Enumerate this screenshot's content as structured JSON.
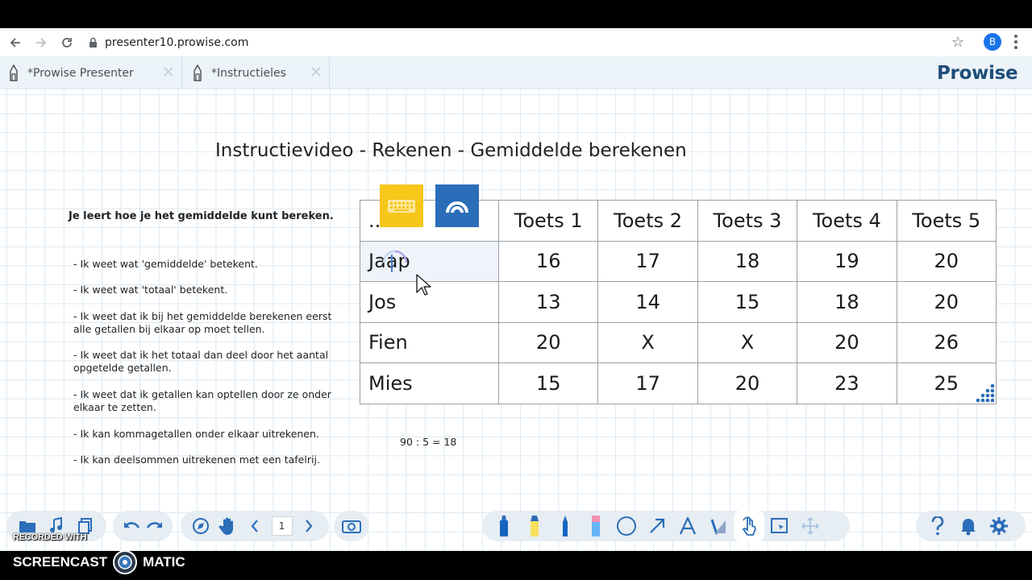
{
  "browser": {
    "url": "presenter10.prowise.com",
    "profile_initial": "B"
  },
  "tabs": [
    {
      "label": "*Prowise Presenter",
      "active": false
    },
    {
      "label": "*Instructieles",
      "active": true
    }
  ],
  "logo": "Prowise",
  "lesson": {
    "title": "Instructievideo - Rekenen - Gemiddelde berekenen",
    "intro": "Je leert hoe je het gemiddelde kunt bereken.",
    "goals": [
      "- Ik weet wat 'gemiddelde' betekent.",
      "- Ik weet wat 'totaal' betekent.",
      "- Ik weet dat ik bij het gemiddelde berekenen eerst alle getallen bij elkaar op moet tellen.",
      "- Ik weet dat ik het totaal dan deel door het aantal opgetelde getallen.",
      "- Ik weet dat ik getallen kan optellen door ze onder elkaar te zetten.",
      "- Ik kan kommagetallen onder elkaar uitrekenen.",
      "- Ik kan deelsommen uitrekenen met een tafelrij."
    ],
    "calculation": "90 : 5 = 18"
  },
  "table": {
    "headers": [
      "...",
      "Toets 1",
      "Toets 2",
      "Toets 3",
      "Toets 4",
      "Toets 5"
    ],
    "rows": [
      [
        "Jaap",
        "16",
        "17",
        "18",
        "19",
        "20"
      ],
      [
        "Jos",
        "13",
        "14",
        "15",
        "18",
        "20"
      ],
      [
        "Fien",
        "20",
        "X",
        "X",
        "20",
        "26"
      ],
      [
        "Mies",
        "15",
        "17",
        "20",
        "23",
        "25"
      ]
    ]
  },
  "toolbar": {
    "page_number": "1"
  },
  "watermark": {
    "top": "RECORDED WITH",
    "brand_left": "SCREENCAST",
    "brand_right": "MATIC"
  },
  "colors": {
    "accent_blue": "#2a6db8",
    "accent_yellow": "#f6c619",
    "logo_blue": "#1f4e79",
    "toolbar_icon": "#2a6db8"
  }
}
